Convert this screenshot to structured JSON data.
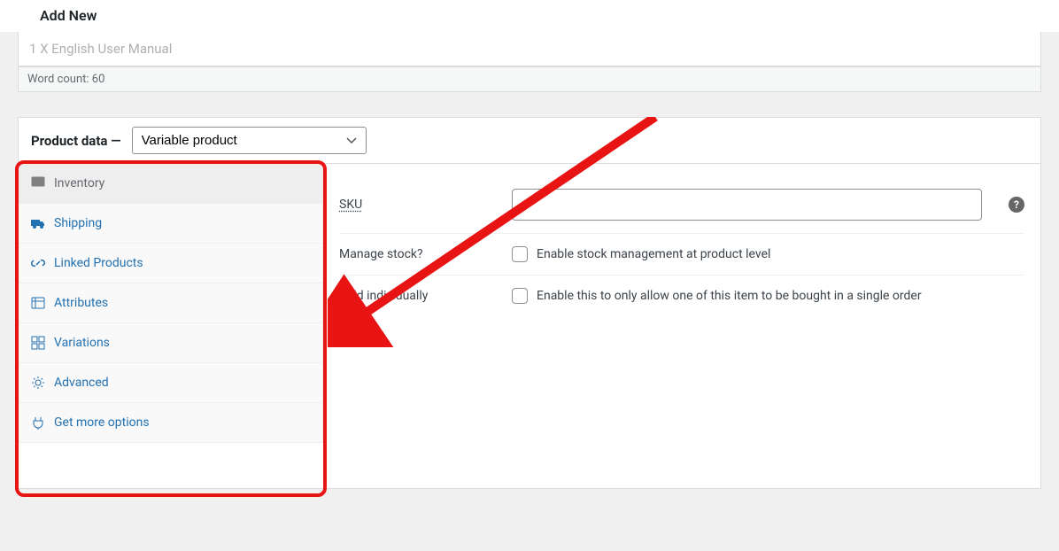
{
  "header": {
    "pageTitle": "Add New"
  },
  "editor": {
    "cutoffLine": "1 X English User Manual",
    "wordCount": "Word count: 60"
  },
  "productData": {
    "panelTitle": "Product data —",
    "typeSelectValue": "Variable product",
    "tabs": [
      {
        "label": "Inventory",
        "active": true
      },
      {
        "label": "Shipping",
        "active": false
      },
      {
        "label": "Linked Products",
        "active": false
      },
      {
        "label": "Attributes",
        "active": false
      },
      {
        "label": "Variations",
        "active": false
      },
      {
        "label": "Advanced",
        "active": false
      },
      {
        "label": "Get more options",
        "active": false
      }
    ],
    "inventory": {
      "skuLabel": "SKU",
      "manageStockLabel": "Manage stock?",
      "manageStockCheckboxLabel": "Enable stock management at product level",
      "soldIndividuallyLabel": "Sold individually",
      "soldIndividuallyCheckboxLabel": "Enable this to only allow one of this item to be bought in a single order"
    }
  },
  "annotation": {
    "type": "arrow-to-sidebar",
    "color": "#e81313"
  }
}
